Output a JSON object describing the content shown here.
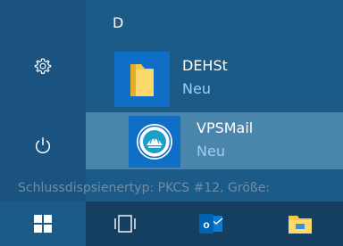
{
  "start_menu": {
    "letter_header": "D",
    "apps": [
      {
        "name": "DEHSt",
        "subtitle": "Neu",
        "icon": "folder-icon"
      },
      {
        "name": "VPSMail",
        "subtitle": "Neu",
        "icon": "vpsmail-logo-icon"
      }
    ]
  },
  "rail": {
    "settings_icon": "gear-icon",
    "power_icon": "power-icon"
  },
  "background_text": "Schlussdispsienertyp: PKCS #12, Größe:",
  "taskbar": {
    "items": [
      {
        "icon": "windows-logo-icon"
      },
      {
        "icon": "task-view-icon"
      },
      {
        "icon": "outlook-icon",
        "label": "o"
      },
      {
        "icon": "file-explorer-icon"
      }
    ]
  },
  "colors": {
    "accent": "#1c5a87",
    "highlight": "#4a86ab",
    "tile": "#0f6fc6",
    "subtitle": "#9bd0f2",
    "taskbar": "#143f61"
  }
}
